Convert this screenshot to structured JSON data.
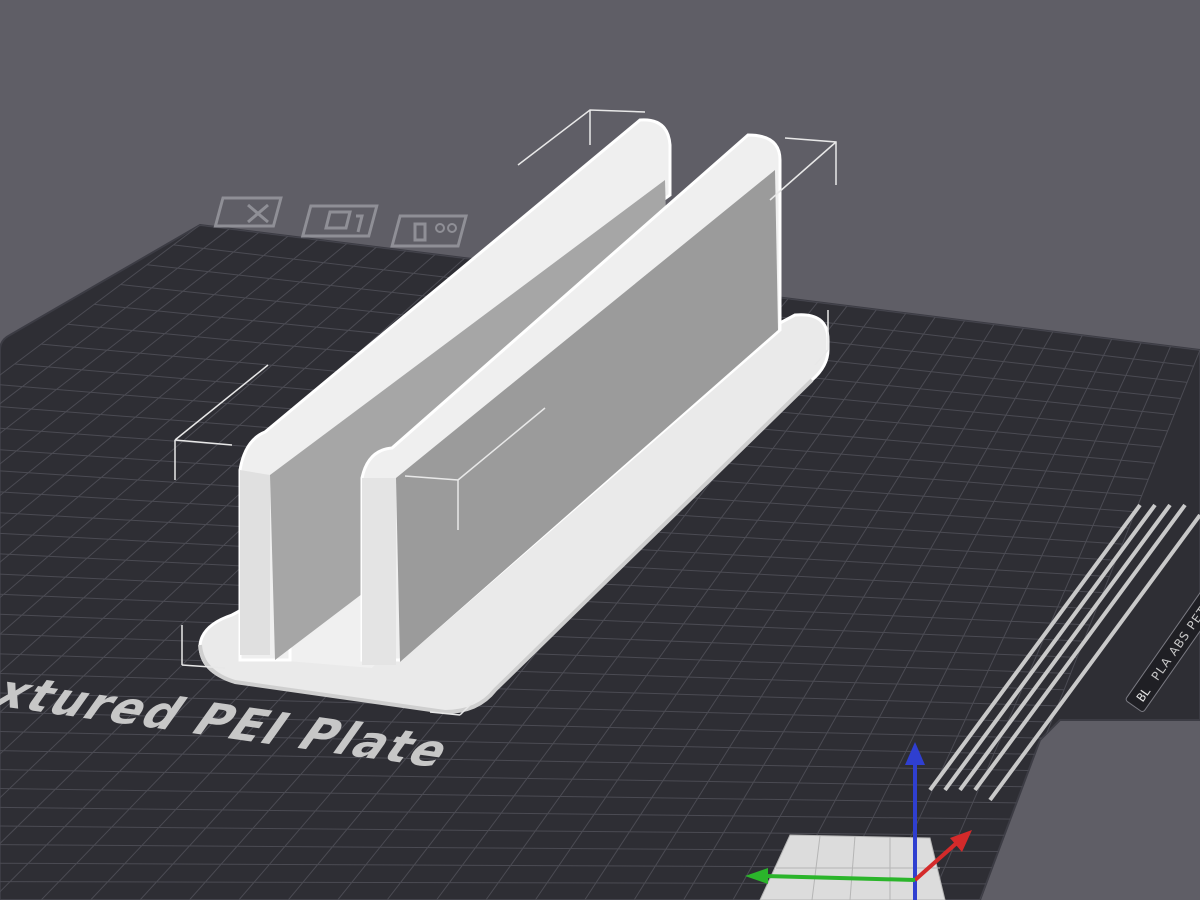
{
  "viewport": {
    "background": "#5f5e66",
    "bed": {
      "color": "#2e2e34",
      "grid_color": "#4b4b53",
      "edge_color": "#3c3c44",
      "label": "xtured PEI Plate",
      "sticker_text": "PLA ABS PETG",
      "logo_text": "BL"
    },
    "plate_toolbar": [
      {
        "name": "delete-plate-icon"
      },
      {
        "name": "arrange-plate-icon"
      },
      {
        "name": "plate-settings-icon"
      }
    ],
    "model": {
      "name": "laptop-stand",
      "color": "#e9e9e9",
      "shadow": "#8e8e8e"
    },
    "axes": {
      "x_color": "#d42a2a",
      "y_color": "#2bb52b",
      "z_color": "#2f3fd0"
    }
  }
}
